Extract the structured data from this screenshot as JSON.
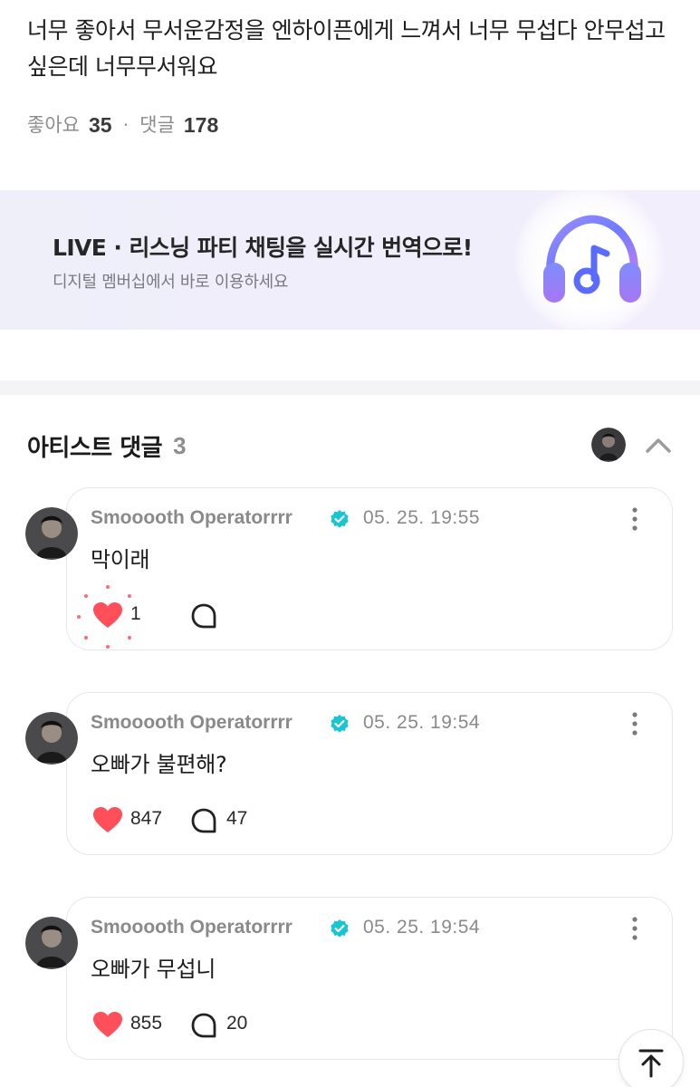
{
  "post": {
    "text": "너무 좋아서 무서운감정을 엔하이픈에게 느껴서 너무 무섭다 안무섭고싶은데 너무무서워요",
    "likes_label": "좋아요",
    "likes_count": "35",
    "separator": "·",
    "comments_label": "댓글",
    "comments_count": "178"
  },
  "banner": {
    "title": "LIVE · 리스닝 파티 채팅을 실시간 번역으로!",
    "subtitle": "디지털 멤버십에서 바로 이용하세요",
    "icon": "headphones-music-icon"
  },
  "artist_comments": {
    "title": "아티스트 댓글",
    "count": "3",
    "collapse_icon": "chevron-up-icon",
    "items": [
      {
        "author": "Smooooth Operatorrrr",
        "time": "05. 25. 19:55",
        "body": "막이래",
        "likes": "1",
        "replies": "",
        "liked_burst": true
      },
      {
        "author": "Smooooth Operatorrrr",
        "time": "05. 25. 19:54",
        "body": "오빠가 불편해?",
        "likes": "847",
        "replies": "47",
        "liked_burst": false
      },
      {
        "author": "Smooooth Operatorrrr",
        "time": "05. 25. 19:54",
        "body": "오빠가 무섭니",
        "likes": "855",
        "replies": "20",
        "liked_burst": false
      }
    ]
  },
  "colors": {
    "heart": "#ff4f5a",
    "verified": "#18c5d0",
    "banner_bg": "#eeeff9",
    "muted_text": "#8a8a8a"
  },
  "scroll_top_icon": "arrow-up-to-top-icon"
}
